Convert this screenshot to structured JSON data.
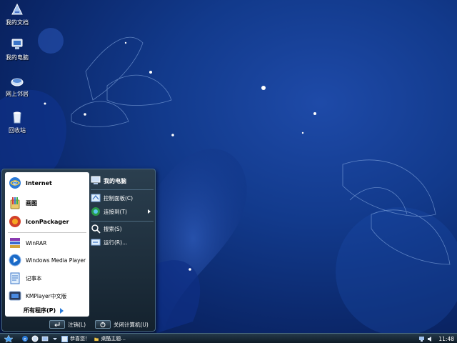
{
  "desktop": {
    "icons": [
      {
        "label": "我的文档",
        "icon": "my-documents-icon"
      },
      {
        "label": "我的电脑",
        "icon": "my-computer-icon"
      },
      {
        "label": "网上邻居",
        "icon": "network-neighborhood-icon"
      },
      {
        "label": "回收站",
        "icon": "recycle-bin-icon"
      }
    ]
  },
  "start_menu": {
    "pinned": [
      {
        "label": "Internet",
        "icon": "internet-explorer-icon"
      },
      {
        "label": "画图",
        "icon": "paint-icon"
      },
      {
        "label": "IconPackager",
        "icon": "iconpackager-icon"
      }
    ],
    "recent": [
      {
        "label": "WinRAR",
        "icon": "winrar-icon"
      },
      {
        "label": "Windows Media Player",
        "icon": "windows-media-player-icon"
      },
      {
        "label": "记事本",
        "icon": "notepad-icon"
      },
      {
        "label": "KMPlayer中文版",
        "icon": "kmplayer-icon"
      }
    ],
    "all_programs": "所有程序(P)",
    "right": {
      "my_computer": "我的电脑",
      "control_panel": "控制面板(C)",
      "connect_to": "连接到(T)",
      "search": "搜索(S)",
      "run": "运行(R)..."
    },
    "bottom": {
      "logoff": "注销(L)",
      "shutdown": "关闭计算机(U)"
    }
  },
  "taskbar": {
    "items": [
      {
        "label": "恭喜您！",
        "icon": "window-icon"
      },
      {
        "label": "桌酷主题...",
        "icon": "folder-icon"
      }
    ],
    "clock": "11:48"
  },
  "colors": {
    "wallpaper_dark": "#061640",
    "wallpaper_light": "#1e4aa8",
    "menu_dark": "#14222e",
    "accent": "#2a7ad8"
  }
}
